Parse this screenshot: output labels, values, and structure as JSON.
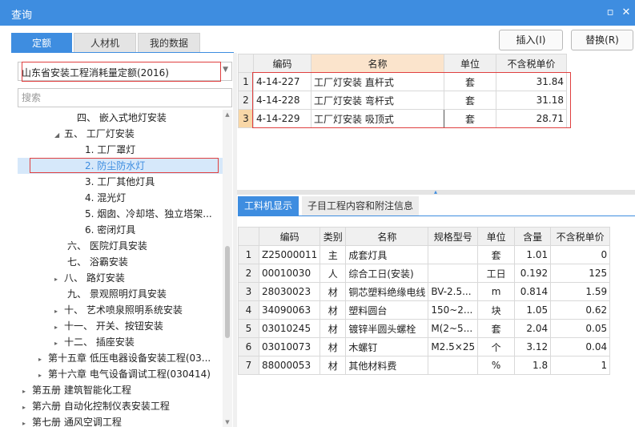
{
  "window": {
    "title": "查询",
    "restore_glyph": "▫",
    "close_glyph": "✕"
  },
  "tabs": [
    {
      "label": "定额",
      "active": true
    },
    {
      "label": "人材机",
      "active": false
    },
    {
      "label": "我的数据",
      "active": false
    }
  ],
  "toolbar": {
    "insert_label": "插入(I)",
    "replace_label": "替换(R)"
  },
  "quota_select": {
    "value": "山东省安装工程消耗量定额(2016)"
  },
  "search": {
    "placeholder": "搜索"
  },
  "tree": [
    {
      "label": "四、 嵌入式地灯安装",
      "caret": ""
    },
    {
      "label": "五、 工厂灯安装",
      "caret": "◢"
    },
    {
      "label": "1. 工厂罩灯",
      "caret": ""
    },
    {
      "label": "2. 防尘防水灯",
      "caret": "",
      "selected": true
    },
    {
      "label": "3. 工厂其他灯具",
      "caret": ""
    },
    {
      "label": "4. 混光灯",
      "caret": ""
    },
    {
      "label": "5. 烟囱、冷却塔、独立塔架...",
      "caret": ""
    },
    {
      "label": "6. 密闭灯具",
      "caret": ""
    },
    {
      "label": "六、 医院灯具安装",
      "caret": ""
    },
    {
      "label": "七、 浴霸安装",
      "caret": ""
    },
    {
      "label": "八、 路灯安装",
      "caret": "▸"
    },
    {
      "label": "九、 景观照明灯具安装",
      "caret": ""
    },
    {
      "label": "十、 艺术喷泉照明系统安装",
      "caret": "▸"
    },
    {
      "label": "十一、 开关、按钮安装",
      "caret": "▸"
    },
    {
      "label": "十二、 插座安装",
      "caret": "▸"
    },
    {
      "label": "第十五章 低压电器设备安装工程(03...",
      "caret": "▸"
    },
    {
      "label": "第十六章 电气设备调试工程(030414)",
      "caret": "▸"
    },
    {
      "label": "第五册 建筑智能化工程",
      "caret": "▸"
    },
    {
      "label": "第六册 自动化控制仪表安装工程",
      "caret": "▸"
    },
    {
      "label": "第七册 通风空调工程",
      "caret": "▸"
    }
  ],
  "quota_table": {
    "headers": [
      "编码",
      "名称",
      "单位",
      "不含税单价"
    ],
    "rows": [
      {
        "n": "1",
        "code": "4-14-227",
        "name": "工厂灯安装 直杆式",
        "unit": "套",
        "price": "31.84"
      },
      {
        "n": "2",
        "code": "4-14-228",
        "name": "工厂灯安装 弯杆式",
        "unit": "套",
        "price": "31.18"
      },
      {
        "n": "3",
        "code": "4-14-229",
        "name": "工厂灯安装 吸顶式",
        "unit": "套",
        "price": "28.71"
      }
    ]
  },
  "bottom_tabs": [
    {
      "label": "工料机显示",
      "active": true
    },
    {
      "label": "子目工程内容和附注信息",
      "active": false
    }
  ],
  "resource_table": {
    "headers": [
      "编码",
      "类别",
      "名称",
      "规格型号",
      "单位",
      "含量",
      "不含税单价"
    ],
    "rows": [
      {
        "n": "1",
        "code": "Z25000011",
        "type": "主",
        "name": "成套灯具",
        "spec": "",
        "unit": "套",
        "qty": "1.01",
        "price": "0"
      },
      {
        "n": "2",
        "code": "00010030",
        "type": "人",
        "name": "综合工日(安装)",
        "spec": "",
        "unit": "工日",
        "qty": "0.192",
        "price": "125"
      },
      {
        "n": "3",
        "code": "28030023",
        "type": "材",
        "name": "铜芯塑料绝缘电线",
        "spec": "BV-2.5...",
        "unit": "m",
        "qty": "0.814",
        "price": "1.59"
      },
      {
        "n": "4",
        "code": "34090063",
        "type": "材",
        "name": "塑料圆台",
        "spec": "150~2...",
        "unit": "块",
        "qty": "1.05",
        "price": "0.62"
      },
      {
        "n": "5",
        "code": "03010245",
        "type": "材",
        "name": "镀锌半圆头螺栓",
        "spec": "M(2~5...",
        "unit": "套",
        "qty": "2.04",
        "price": "0.05"
      },
      {
        "n": "6",
        "code": "03010073",
        "type": "材",
        "name": "木螺钉",
        "spec": "M2.5×25",
        "unit": "个",
        "qty": "3.12",
        "price": "0.04"
      },
      {
        "n": "7",
        "code": "88000053",
        "type": "材",
        "name": "其他材料费",
        "spec": "",
        "unit": "%",
        "qty": "1.8",
        "price": "1"
      }
    ]
  },
  "colors": {
    "accent": "#3e8de0",
    "highlight_box": "#e04040",
    "name_header": "#fbe4cc"
  }
}
